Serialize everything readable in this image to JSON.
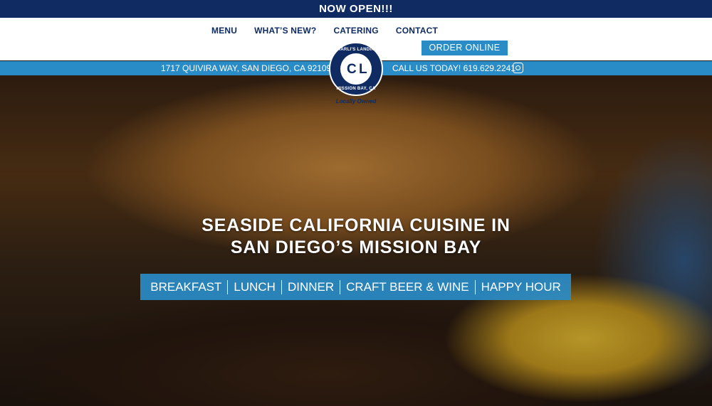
{
  "banner": {
    "text": "NOW OPEN!!!"
  },
  "nav": {
    "items": [
      {
        "label": "MENU"
      },
      {
        "label": "WHAT’S NEW?"
      },
      {
        "label": "CATERING"
      },
      {
        "label": "CONTACT"
      }
    ],
    "order_label": "ORDER ONLINE"
  },
  "info": {
    "address": "1717 QUIVIRA WAY, SAN DIEGO, CA 92109",
    "phone": "CALL US TODAY! 619.629.2241"
  },
  "logo": {
    "top_text": "CHARLI'S LANDING",
    "bottom_text": "MISSION BAY, CA",
    "letter_c": "C",
    "letter_l": "L",
    "tagline": "Locally Owned"
  },
  "hero": {
    "headline_1": "SEASIDE CALIFORNIA CUISINE IN",
    "headline_2": "SAN DIEGO’S MISSION BAY",
    "categories": [
      "BREAKFAST",
      "LUNCH",
      "DINNER",
      "CRAFT BEER & WINE",
      "HAPPY HOUR"
    ]
  },
  "colors": {
    "navy": "#0f2b62",
    "blue": "#2a8cc7",
    "white": "#ffffff"
  },
  "icons": {
    "social": "instagram-icon"
  }
}
